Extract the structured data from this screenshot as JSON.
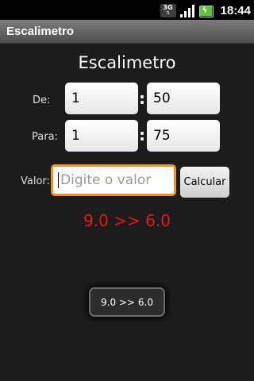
{
  "status_bar": {
    "network_type": "3G",
    "time": "18:44",
    "icons": [
      "3g-data-icon",
      "signal-strength-icon",
      "battery-charging-icon"
    ]
  },
  "title_bar": {
    "title": "Escalimetro"
  },
  "main": {
    "heading": "Escalimetro",
    "de": {
      "label": "De:",
      "left_value": "1",
      "right_value": "50"
    },
    "para": {
      "label": "Para:",
      "left_value": "1",
      "right_value": "75"
    },
    "separator": ":",
    "valor": {
      "label": "Valor:",
      "value": "",
      "placeholder": "Digite o valor"
    },
    "calculate_button": "Calcular",
    "result": "9.0 >> 6.0"
  },
  "toast": {
    "message": "9.0 >> 6.0"
  },
  "colors": {
    "accent_focus": "#f09419",
    "result_text": "#e11818",
    "background": "#1c1c1c"
  }
}
